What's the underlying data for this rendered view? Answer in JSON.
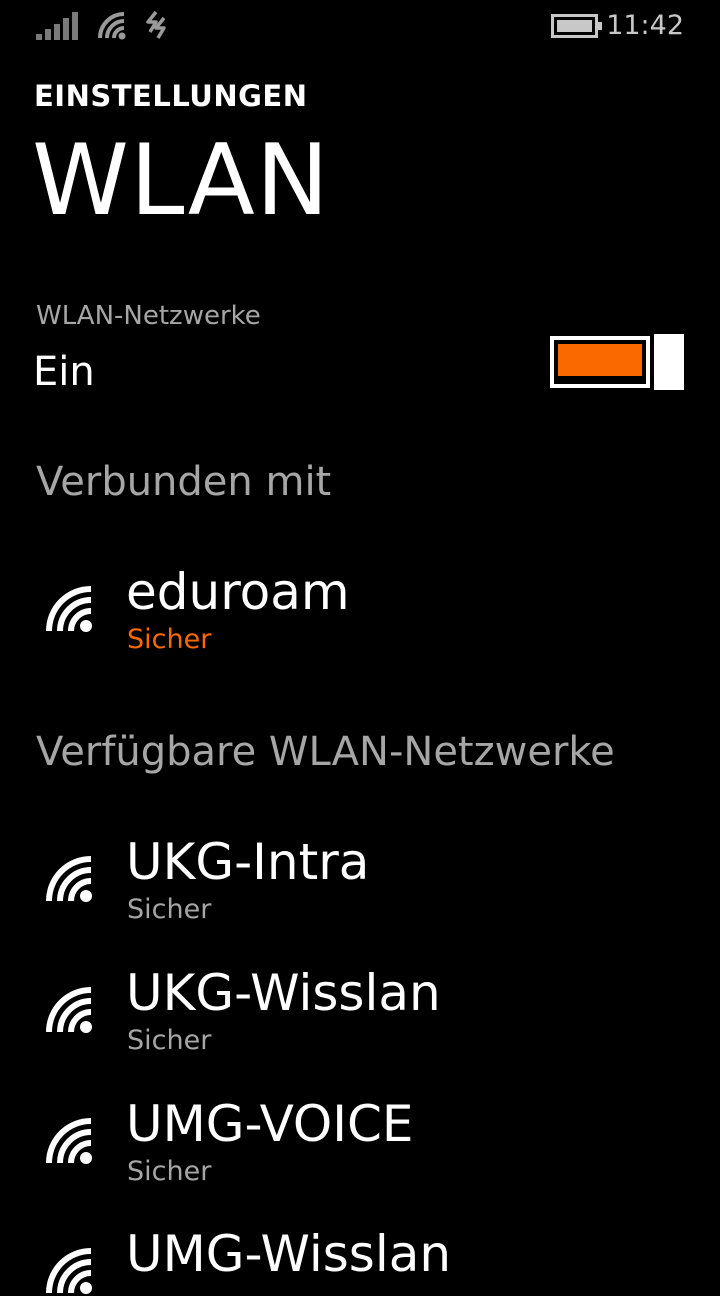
{
  "status_bar": {
    "time": "11:42",
    "icons": [
      "signal-strength-icon",
      "wifi-icon",
      "data-connection-icon",
      "battery-icon"
    ]
  },
  "header": {
    "app_title": "EINSTELLUNGEN",
    "page_title": "WLAN"
  },
  "wifi_toggle": {
    "label": "WLAN-Netzwerke",
    "state_text": "Ein",
    "on": true
  },
  "connected": {
    "header": "Verbunden mit",
    "network": {
      "name": "eduroam",
      "status": "Sicher"
    }
  },
  "available": {
    "header": "Verfügbare WLAN-Netzwerke",
    "networks": [
      {
        "name": "UKG-Intra",
        "status": "Sicher"
      },
      {
        "name": "UKG-Wisslan",
        "status": "Sicher"
      },
      {
        "name": "UMG-VOICE",
        "status": "Sicher"
      },
      {
        "name": "UMG-Wisslan",
        "status": ""
      }
    ]
  },
  "colors": {
    "accent": "#fa6800",
    "background": "#000000",
    "foreground": "#ffffff",
    "secondary_text": "#a6a6a6"
  }
}
